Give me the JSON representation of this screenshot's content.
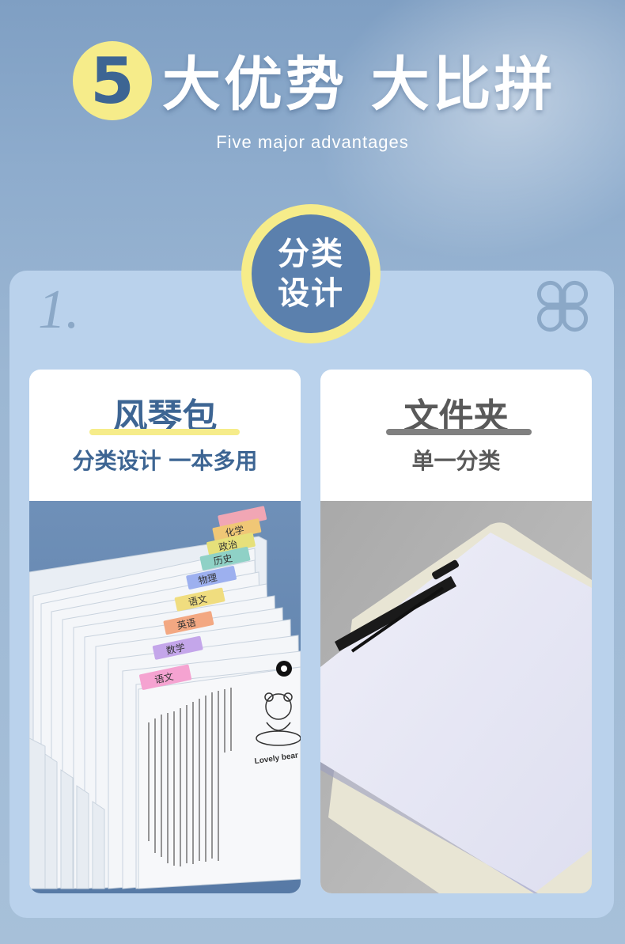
{
  "header": {
    "number": "5",
    "title": "大优势 大比拼",
    "subtitle": "Five major advantages"
  },
  "panel": {
    "index": "1.",
    "badge_line1": "分类",
    "badge_line2": "设计",
    "icon": "clover-icon"
  },
  "cards": {
    "left": {
      "title": "风琴包",
      "subtitle": "分类设计 一本多用",
      "tabs": [
        "化学",
        "政治",
        "历史",
        "物理",
        "语文",
        "英语",
        "数学",
        "语文"
      ],
      "bear_caption": "Lovely bear"
    },
    "right": {
      "title": "文件夹",
      "subtitle": "单一分类"
    }
  },
  "colors": {
    "accent_yellow": "#f6ec8a",
    "brand_blue": "#3d6593",
    "panel_bg": "#bad2ec"
  }
}
